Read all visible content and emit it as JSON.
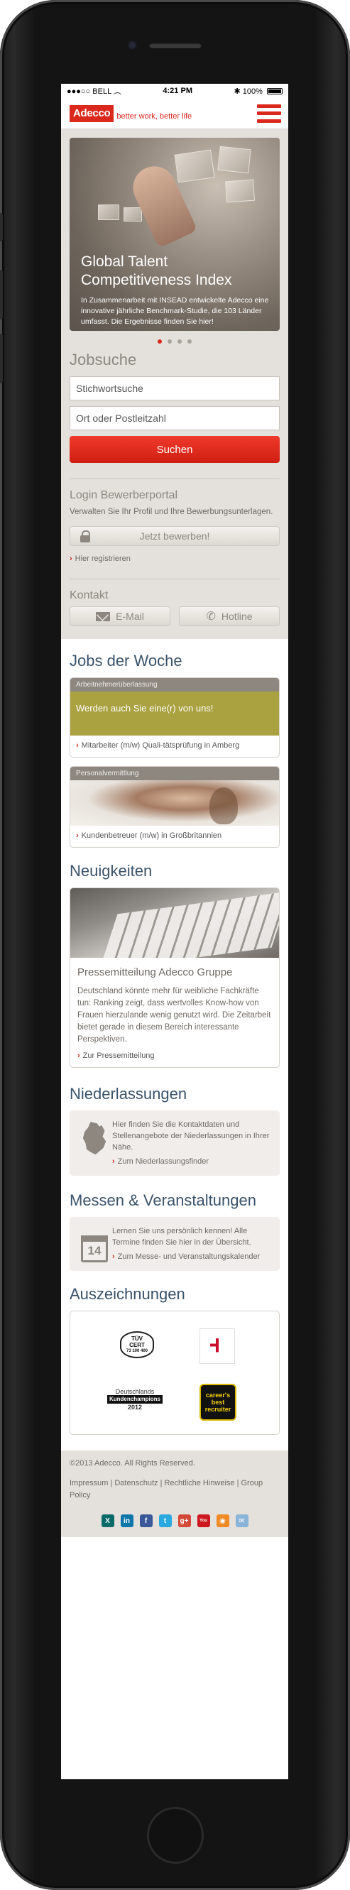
{
  "status_bar": {
    "signal": "●●●○○",
    "carrier": "BELL",
    "time": "4:21 PM",
    "battery": "100%"
  },
  "header": {
    "logo": "Adecco",
    "tagline": "better work, better life"
  },
  "hero": {
    "title": "Global Talent Competitiveness Index",
    "text": "In Zusammenarbeit mit INSEAD entwickelte Adecco eine innovative jährliche Benchmark-Studie, die 103 Länder umfasst. Die Ergebnisse finden Sie hier!",
    "slides": 4,
    "active_slide": 1
  },
  "jobsuche": {
    "title": "Jobsuche",
    "keyword_placeholder": "Stichwortsuche",
    "location_placeholder": "Ort oder Postleitzahl",
    "search_label": "Suchen"
  },
  "login": {
    "title": "Login Bewerberportal",
    "text": "Verwalten Sie Ihr Profil und Ihre Bewerbungsunterlagen.",
    "apply_label": "Jetzt bewerben!",
    "register_label": "Hier registrieren"
  },
  "kontakt": {
    "title": "Kontakt",
    "email_label": "E-Mail",
    "hotline_label": "Hotline"
  },
  "jobs": {
    "title": "Jobs der Woche",
    "items": [
      {
        "category": "Arbeitnehmerüberlassung",
        "teaser": "Werden auch Sie eine(r) von uns!",
        "link": "Mitarbeiter (m/w) Quali-tätsprüfung in Amberg"
      },
      {
        "category": "Personalvermittlung",
        "link": "Kundenbetreuer (m/w) in Großbritannien"
      }
    ]
  },
  "news": {
    "title": "Neuigkeiten",
    "item_title": "Pressemitteilung Adecco Gruppe",
    "item_text": "Deutschland könnte mehr für weibliche Fachkräfte tun: Ranking zeigt, dass wertvolles Know-how von Frauen hierzulande wenig genutzt wird. Die Zeitarbeit bietet gerade in diesem Bereich interessante Perspektiven.",
    "item_link": "Zur Pressemitteilung"
  },
  "branches": {
    "title": "Niederlassungen",
    "text": "Hier finden Sie die Kontaktdaten und Stellenangebote der Niederlassungen in Ihrer Nähe.",
    "link": "Zum Niederlassungsfinder"
  },
  "events": {
    "title": "Messen & Veranstaltungen",
    "text": "Lernen Sie uns persönlich kennen! Alle Termine finden Sie hier in der Übersicht.",
    "link": "Zum Messe- und Veranstaltungskalender",
    "calendar_day": "14"
  },
  "awards": {
    "title": "Auszeichnungen",
    "tuv": {
      "line1": "TÜV",
      "line2": "CERT",
      "line3": "73 100 400"
    },
    "kundenchampions": {
      "line1": "Deutschlands",
      "line2": "Kundenchampions",
      "line3": "2012"
    },
    "recruiter": {
      "line1": "career's",
      "line2": "best",
      "line3": "recruiter"
    }
  },
  "footer": {
    "copyright": "©2013 Adecco. All Rights Reserved.",
    "links": "Impressum | Datenschutz | Rechtliche Hinweise | Group Policy",
    "social": [
      {
        "name": "xing",
        "glyph": "X",
        "color": "#0a6a6a"
      },
      {
        "name": "linkedin",
        "glyph": "in",
        "color": "#0e76a8"
      },
      {
        "name": "facebook",
        "glyph": "f",
        "color": "#3b5998"
      },
      {
        "name": "twitter",
        "glyph": "t",
        "color": "#2aa9e0"
      },
      {
        "name": "google-plus",
        "glyph": "g+",
        "color": "#d34836"
      },
      {
        "name": "youtube",
        "glyph": "You",
        "color": "#cc181e"
      },
      {
        "name": "rss",
        "glyph": "◉",
        "color": "#f08a24"
      },
      {
        "name": "email",
        "glyph": "✉",
        "color": "#8ab4d8"
      }
    ]
  }
}
